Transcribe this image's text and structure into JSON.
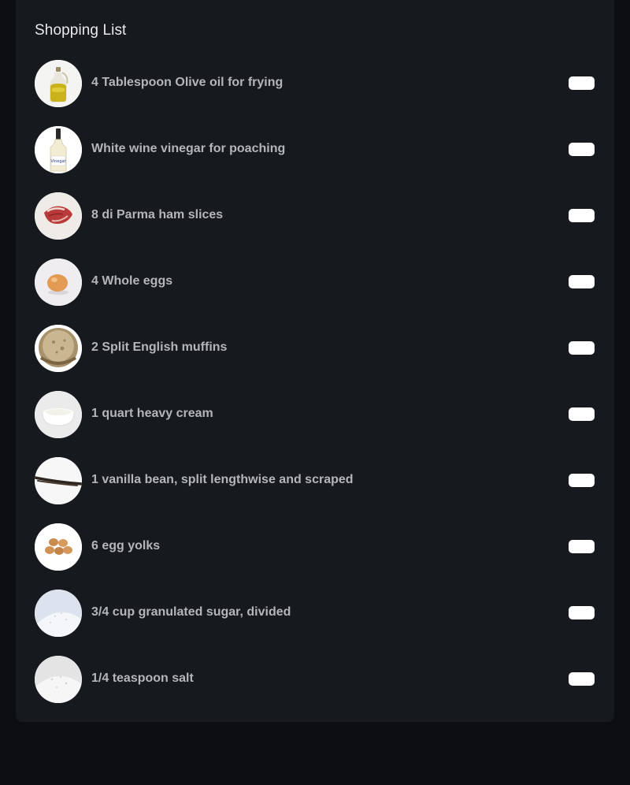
{
  "title": "Shopping List",
  "items": [
    {
      "label": "4 Tablespoon Olive oil for frying",
      "icon": "olive-oil-bottle-icon",
      "checked": false
    },
    {
      "label": "White wine vinegar for poaching",
      "icon": "vinegar-bottle-icon",
      "checked": false
    },
    {
      "label": "8 di Parma ham slices",
      "icon": "parma-ham-icon",
      "checked": false
    },
    {
      "label": "4 Whole eggs",
      "icon": "egg-icon",
      "checked": false
    },
    {
      "label": "2 Split English muffins",
      "icon": "english-muffin-icon",
      "checked": false
    },
    {
      "label": "1 quart heavy cream",
      "icon": "cream-bowl-icon",
      "checked": false
    },
    {
      "label": "1 vanilla bean, split lengthwise and scraped",
      "icon": "vanilla-bean-icon",
      "checked": false
    },
    {
      "label": "6 egg yolks",
      "icon": "egg-yolks-icon",
      "checked": false
    },
    {
      "label": "3/4 cup granulated sugar, divided",
      "icon": "sugar-icon",
      "checked": false
    },
    {
      "label": "1/4 teaspoon salt",
      "icon": "salt-icon",
      "checked": false
    }
  ]
}
